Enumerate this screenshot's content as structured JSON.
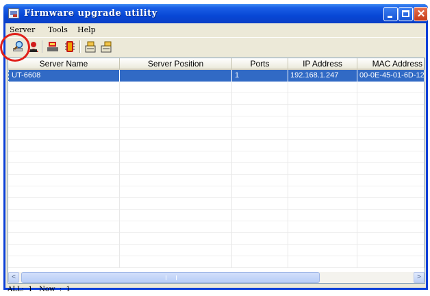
{
  "window": {
    "title": "Firmware upgrade utility",
    "buttons": {
      "minimize": "_",
      "maximize": "□",
      "close": "✕"
    }
  },
  "menu": {
    "items": [
      {
        "label": "Server"
      },
      {
        "label": "Tools"
      },
      {
        "label": "Help"
      }
    ]
  },
  "toolbar": {
    "icons": [
      "search-server-icon",
      "user-red-icon",
      "server-connect-icon",
      "firmware-chip-icon",
      "export-icon",
      "import-icon"
    ]
  },
  "table": {
    "columns": [
      "Server Name",
      "Server Position",
      "Ports",
      "IP Address",
      "MAC Address"
    ],
    "rows": [
      {
        "server_name": "UT-6608",
        "server_position": "",
        "ports": "1",
        "ip_address": "192.168.1.247",
        "mac_address": "00-0E-45-01-6D-12"
      }
    ]
  },
  "scrollbar": {
    "left_arrow": "<",
    "right_arrow": ">"
  },
  "status": {
    "text": "ALL:  1   Now  :  1"
  },
  "colors": {
    "selection": "#316ac5",
    "title_bar": "#0847d6",
    "annotation": "#e0201a"
  }
}
